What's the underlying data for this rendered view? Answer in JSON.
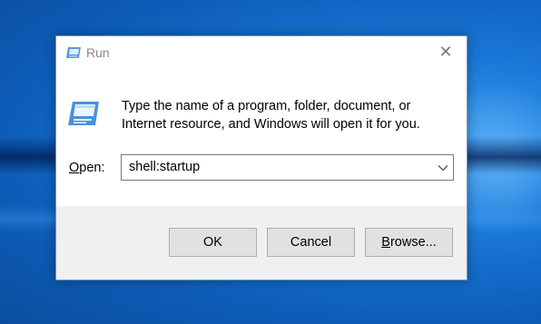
{
  "dialog": {
    "title": "Run",
    "close_glyph": "✕",
    "message": "Type the name of a program, folder, document, or Internet resource, and Windows will open it for you.",
    "open_label_accel": "O",
    "open_label_rest": "pen:",
    "open_value": "shell:startup",
    "buttons": {
      "ok": "OK",
      "cancel": "Cancel",
      "browse_accel": "B",
      "browse_rest": "rowse..."
    }
  },
  "icons": {
    "title": "run-app-icon",
    "main": "run-app-icon",
    "dropdown": "chevron-down-icon",
    "close": "close-icon"
  },
  "colors": {
    "desktop": "#1166c4",
    "dialog_bg": "#ffffff",
    "footer_bg": "#f0f0f0",
    "button_bg": "#e1e1e1"
  }
}
